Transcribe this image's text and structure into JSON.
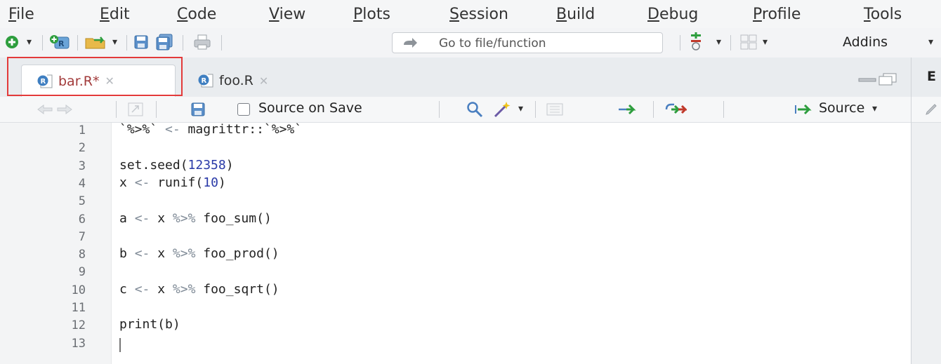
{
  "menu": [
    {
      "label": "File",
      "key": "F"
    },
    {
      "label": "Edit",
      "key": "E"
    },
    {
      "label": "Code",
      "key": "C"
    },
    {
      "label": "View",
      "key": "V"
    },
    {
      "label": "Plots",
      "key": "P"
    },
    {
      "label": "Session",
      "key": "S"
    },
    {
      "label": "Build",
      "key": "B"
    },
    {
      "label": "Debug",
      "key": "D"
    },
    {
      "label": "Profile",
      "key": "P"
    },
    {
      "label": "Tools",
      "key": "T"
    }
  ],
  "toolbar": {
    "goto_placeholder": "Go to file/function",
    "addins_label": "Addins"
  },
  "tabs": [
    {
      "label": "bar.R*",
      "active": true
    },
    {
      "label": "foo.R",
      "active": false
    }
  ],
  "right_pane": {
    "title": "E"
  },
  "editor_toolbar": {
    "source_on_save_label": "Source on Save",
    "source_label": "Source"
  },
  "code_lines": [
    {
      "num": "1",
      "text": "`%>%` <- magrittr::`%>%`"
    },
    {
      "num": "2",
      "text": ""
    },
    {
      "num": "3",
      "text": "set.seed(12358)"
    },
    {
      "num": "4",
      "text": "x <- runif(10)"
    },
    {
      "num": "5",
      "text": ""
    },
    {
      "num": "6",
      "text": "a <- x %>% foo_sum()"
    },
    {
      "num": "7",
      "text": ""
    },
    {
      "num": "8",
      "text": "b <- x %>% foo_prod()"
    },
    {
      "num": "9",
      "text": ""
    },
    {
      "num": "10",
      "text": "c <- x %>% foo_sqrt()"
    },
    {
      "num": "11",
      "text": ""
    },
    {
      "num": "12",
      "text": "print(b)"
    },
    {
      "num": "13",
      "text": ""
    }
  ],
  "colors": {
    "highlight": "#e33a3a",
    "number": "#2a3aa8",
    "operator": "#7f8a96",
    "active_tab_text": "#a23b3b"
  }
}
